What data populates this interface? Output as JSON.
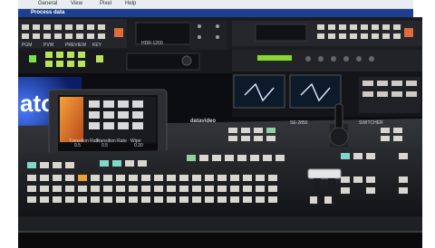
{
  "menu": {
    "items": [
      "General",
      "View",
      "Pixel",
      "Help"
    ]
  },
  "window_title": "Process data",
  "image": {
    "description_text_visible": {
      "brand_logo_fragment": "ato",
      "panel_brand": "datavideo",
      "top_left_labels": [
        "PGM",
        "PVW",
        "PREVIEW",
        "KEY"
      ],
      "recorder_label": "HDR-1200",
      "monitor_labels": [
        "Transition Rate",
        "Transition Rate",
        "Wipe"
      ],
      "monitor_values": [
        "0.5",
        "0.5",
        "0.30"
      ],
      "console_labels": [
        "SE-2850",
        "SWITCHER"
      ]
    }
  },
  "colors": {
    "menu_bg": "#e9ecf1",
    "title_bg": "#1e3f8f",
    "panel_dark": "#1a1b1f",
    "button_light": "#d9d6cf",
    "button_green": "#8fd1a0",
    "button_amber": "#e8a33d",
    "led_green": "#7be04a",
    "screen_orange": "#f08a2a",
    "wall_blue": "#2a5bff"
  }
}
